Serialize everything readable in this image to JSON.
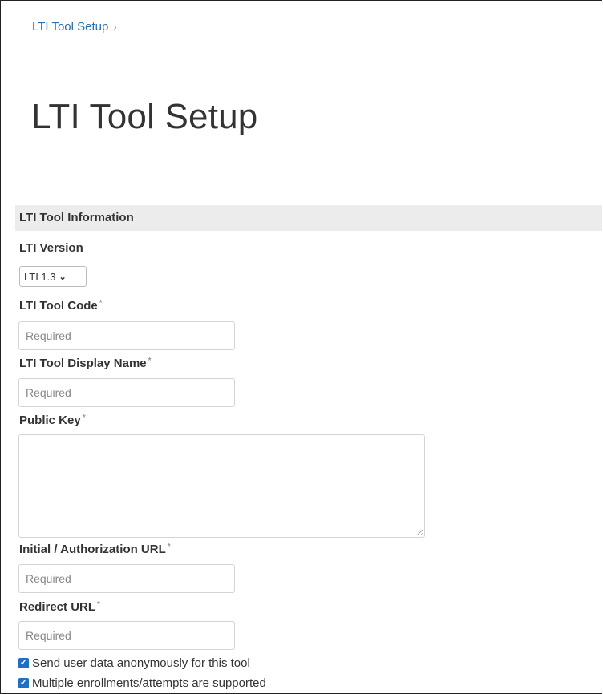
{
  "breadcrumb": {
    "item": "LTI Tool Setup",
    "separator": "›"
  },
  "page_title": "LTI Tool Setup",
  "section": {
    "title": "LTI Tool Information"
  },
  "fields": {
    "lti_version": {
      "label": "LTI Version",
      "selected": "LTI 1.3"
    },
    "tool_code": {
      "label": "LTI Tool Code",
      "required_mark": "*",
      "placeholder": "Required"
    },
    "display_name": {
      "label": "LTI Tool Display Name",
      "required_mark": "*",
      "placeholder": "Required"
    },
    "public_key": {
      "label": "Public Key",
      "required_mark": "*"
    },
    "auth_url": {
      "label": "Initial / Authorization URL",
      "required_mark": "*",
      "placeholder": "Required"
    },
    "redirect_url": {
      "label": "Redirect URL",
      "required_mark": "*",
      "placeholder": "Required"
    }
  },
  "checkboxes": [
    {
      "label": "Send user data anonymously for this tool",
      "checked": true
    },
    {
      "label": "Multiple enrollments/attempts are supported",
      "checked": true
    }
  ],
  "colors": {
    "link": "#2a6fb0",
    "checkbox": "#1f6fc4",
    "section_bg": "#ececec"
  }
}
